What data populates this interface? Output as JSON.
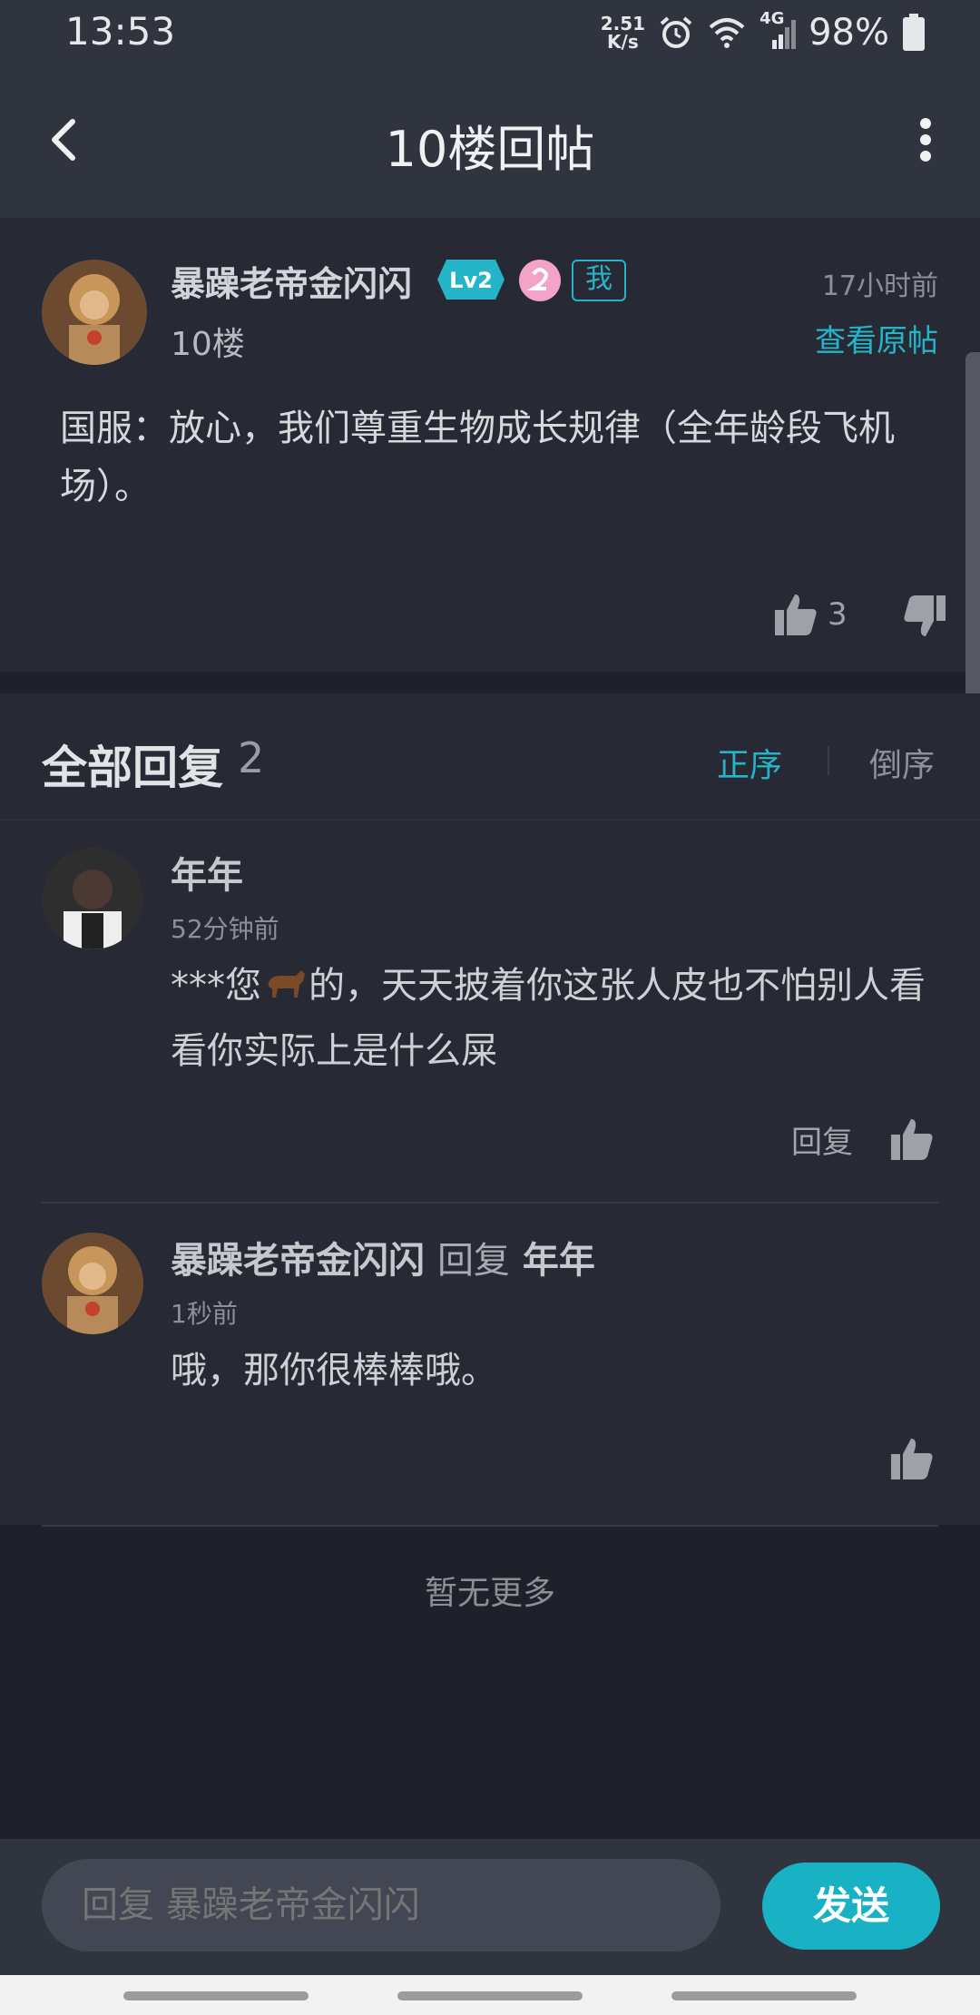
{
  "status_bar": {
    "time": "13:53",
    "net_speed_value": "2.51",
    "net_speed_unit": "K/s",
    "network": "4G",
    "battery": "98%"
  },
  "app_bar": {
    "title": "10楼回帖",
    "back_icon": "chevron-left-icon",
    "more_icon": "more-vertical-icon"
  },
  "post": {
    "author": "暴躁老帝金闪闪",
    "level": "Lv2",
    "me_tag": "我",
    "floor": "10楼",
    "time": "17小时前",
    "view_original": "查看原帖",
    "content": "国服：放心，我们尊重生物成长规律（全年龄段飞机场）。",
    "likes": "3"
  },
  "replies_header": {
    "label": "全部回复",
    "count": "2",
    "sort_asc": "正序",
    "sort_desc": "倒序"
  },
  "replies": [
    {
      "name": "年年",
      "time": "52分钟前",
      "text_before": "***您",
      "text_after": "的，天天披着你这张人皮也不怕别人看看你实际上是什么屎",
      "reply_label": "回复"
    },
    {
      "name": "暴躁老帝金闪闪",
      "reply_word": "回复",
      "reply_to": "年年",
      "time": "1秒前",
      "text": "哦，那你很棒棒哦。"
    }
  ],
  "no_more": "暂无更多",
  "input": {
    "placeholder": "回复 暴躁老帝金闪闪",
    "send_label": "发送"
  },
  "colors": {
    "accent": "#18b2c4",
    "background": "#1f2029",
    "card": "#272934",
    "header": "#30343f"
  }
}
